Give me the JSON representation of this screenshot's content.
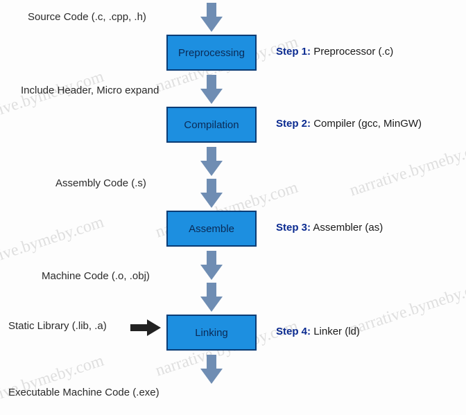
{
  "inputs": {
    "source": "Source Code (.c, .cpp, .h)",
    "headers": "Include Header, Micro expand",
    "assembly": "Assembly Code (.s)",
    "machine": "Machine Code (.o, .obj)",
    "static_lib": "Static Library (.lib, .a)",
    "output": "Executable Machine Code (.exe)"
  },
  "stages": [
    {
      "label": "Preprocessing",
      "step_prefix": "Step 1:",
      "step_text": "Preprocessor (.c)"
    },
    {
      "label": "Compilation",
      "step_prefix": "Step 2:",
      "step_text": "Compiler (gcc, MinGW)"
    },
    {
      "label": "Assemble",
      "step_prefix": "Step 3:",
      "step_text": "Assembler (as)"
    },
    {
      "label": "Linking",
      "step_prefix": "Step 4:",
      "step_text": "Linker (ld)"
    }
  ],
  "watermark": "narrative.bymeby.com"
}
